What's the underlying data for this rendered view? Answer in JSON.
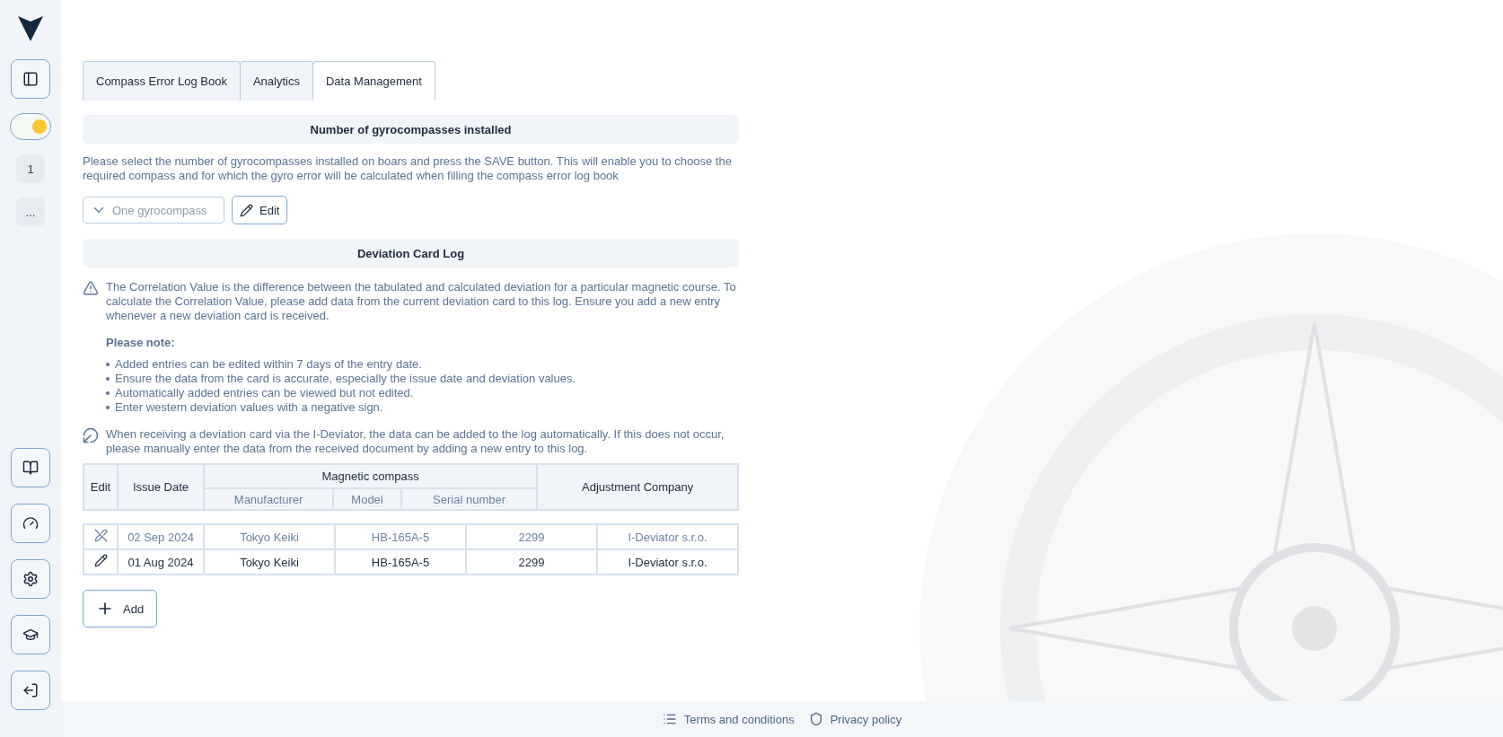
{
  "sidebar": {
    "theme_toggle": {
      "on": true
    },
    "pages": [
      {
        "label": "1"
      },
      {
        "label": "..."
      }
    ]
  },
  "tabs": [
    {
      "label": "Compass Error Log Book",
      "selected": false
    },
    {
      "label": "Analytics",
      "selected": false
    },
    {
      "label": "Data Management",
      "selected": true
    }
  ],
  "gyro_section": {
    "title": "Number of gyrocompasses installed",
    "description": "Please select the number of gyrocompasses installed on boars and press the SAVE button. This will enable you to choose the required compass and for which the gyro error will be calculated when filling the compass error log book",
    "select": {
      "placeholder": "One gyrocompass"
    },
    "edit_button": "Edit"
  },
  "deviation_section": {
    "title": "Deviation Card Log",
    "warning": "The Correlation Value is the difference between the tabulated and calculated deviation for a particular magnetic course. To calculate the Correlation Value, please add data from the current deviation card to this log. Ensure you add a new entry whenever a new deviation card is received.",
    "note_title": "Please note:",
    "notes": [
      "Added entries can be edited within 7 days of the entry date.",
      "Ensure the data from the card is accurate, especially the issue date and deviation values.",
      "Automatically added entries can be viewed but not edited.",
      "Enter western deviation values with a negative sign."
    ],
    "info": "When receiving a deviation card via the I-Deviator, the data can be added to the log automatically. If this does not occur, please manually enter the data from the received document by adding a new entry to this log."
  },
  "table": {
    "headers": {
      "edit": "Edit",
      "issue_date": "Issue Date",
      "group": "Magnetic compass",
      "manufacturer": "Manufacturer",
      "model": "Model",
      "serial": "Serial number",
      "company": "Adjustment Company"
    },
    "rows": [
      {
        "disabled": true,
        "cells": [
          "02 Sep 2024",
          "Tokyo Keiki",
          "HB-165A-5",
          "2299",
          "I-Deviator s.r.o."
        ]
      },
      {
        "disabled": false,
        "cells": [
          "01 Aug 2024",
          "Tokyo Keiki",
          "HB-165A-5",
          "2299",
          "I-Deviator s.r.o."
        ]
      }
    ]
  },
  "add_button": "Add",
  "footer": {
    "links": [
      "Terms and conditions",
      "Privacy policy"
    ]
  }
}
